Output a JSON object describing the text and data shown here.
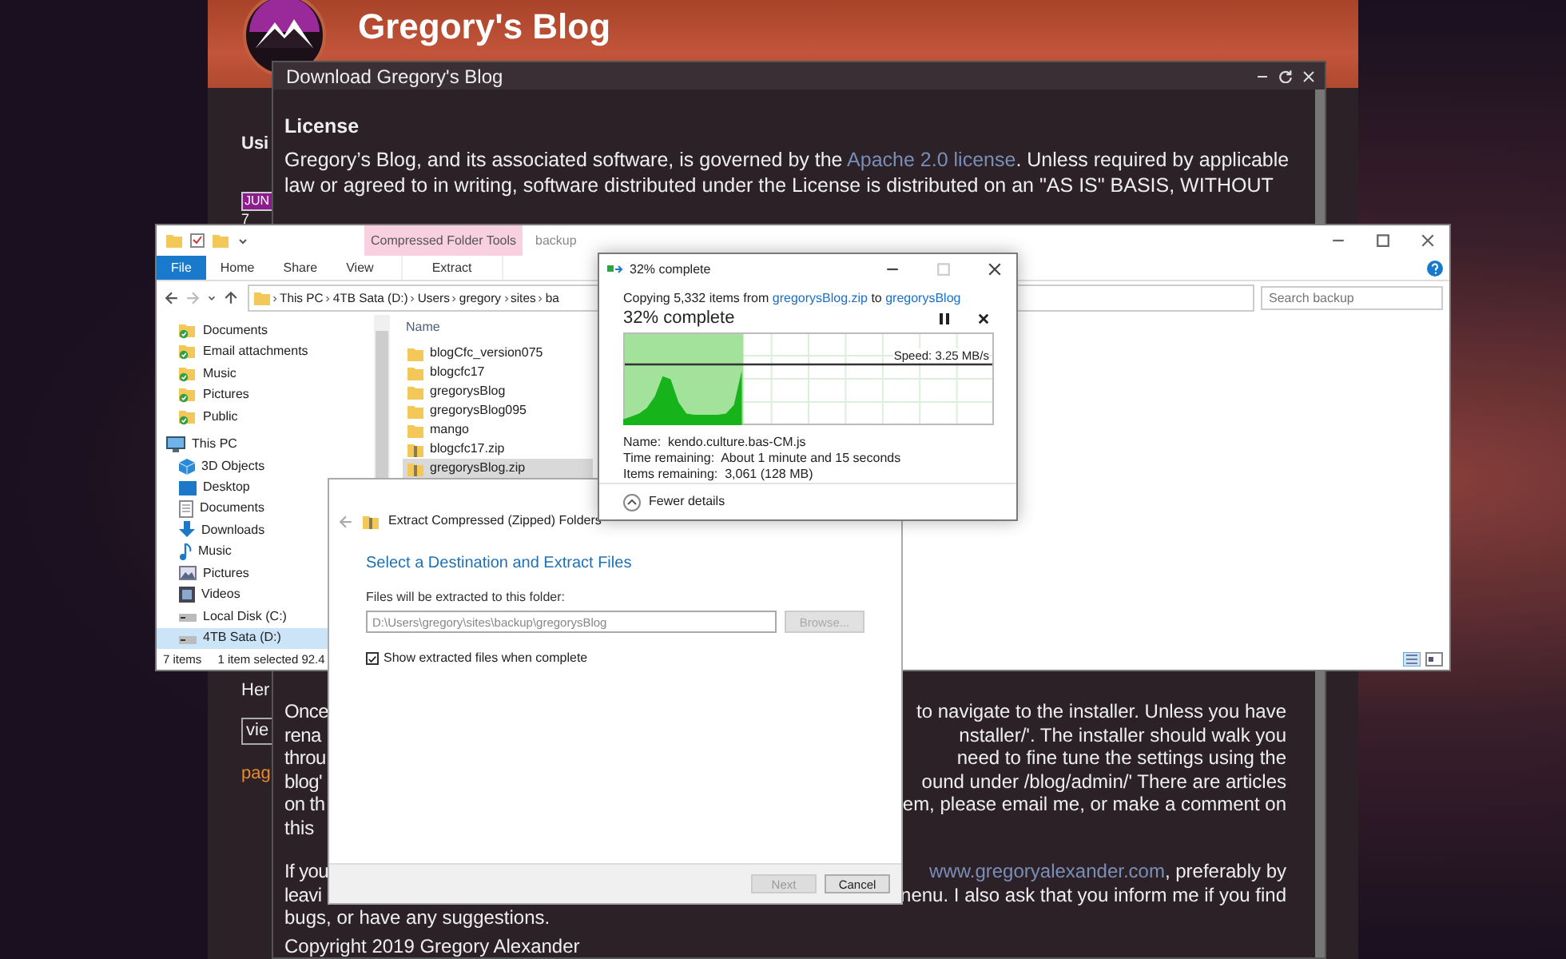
{
  "blog": {
    "title": "Gregory's Blog",
    "sidebar_fragments": [
      {
        "kind": "heading",
        "text": "Usi"
      },
      {
        "kind": "date-tab",
        "text": "JUN"
      },
      {
        "kind": "day",
        "text": "7"
      },
      {
        "kind": "text",
        "text": "Her"
      },
      {
        "kind": "tab",
        "text": "vie"
      },
      {
        "kind": "link",
        "text": "pag"
      }
    ]
  },
  "modal": {
    "title": "Download Gregory's Blog",
    "heading": "License",
    "license_line_1": {
      "before": "Gregory’s Blog, and its associated software, is governed by the ",
      "link": "Apache 2.0 license",
      "after": ". Unless required by applicable"
    },
    "license_line_2": "law or agreed to in writing, software distributed under the License is distributed on an \"AS IS\" BASIS, WITHOUT",
    "lower_lines": [
      {
        "left": "Once",
        "right": "to navigate to the installer. Unless you have"
      },
      {
        "left": "rena",
        "right": "nstaller/'. The installer should walk you"
      },
      {
        "left": "throu",
        "right": "need to fine tune the settings using the"
      },
      {
        "left": "blog'",
        "right": "ound under /blog/admin/' There are articles"
      },
      {
        "left": "on th",
        "right": "em, please email me, or make a comment on"
      },
      {
        "left": "this"
      },
      {
        "left": "If you",
        "link": "www.gregoryalexander.com",
        "right": ", preferably by"
      },
      {
        "left": "leavi",
        "right": "nenu. I also ask that you inform me if you find"
      },
      {
        "left": "bugs, or have any suggestions."
      },
      {
        "left": "Copyright 2019 Gregory Alexander"
      }
    ]
  },
  "explorer": {
    "context_tab": "Compressed Folder Tools",
    "title": "backup",
    "tabs": [
      {
        "label": "File",
        "selected": true
      },
      {
        "label": "Home",
        "selected": false
      },
      {
        "label": "Share",
        "selected": false
      },
      {
        "label": "View",
        "selected": false
      },
      {
        "label": "Extract",
        "selected": false
      }
    ],
    "path": [
      "This PC",
      "4TB Sata (D:)",
      "Users",
      "gregory",
      "sites",
      "ba"
    ],
    "search": {
      "placeholder": "Search backup"
    },
    "nav": [
      {
        "label": "Documents",
        "kind": "synced-folder",
        "selected": false
      },
      {
        "label": "Email attachments",
        "kind": "synced-folder",
        "selected": false
      },
      {
        "label": "Music",
        "kind": "synced-folder",
        "selected": false
      },
      {
        "label": "Pictures",
        "kind": "synced-folder",
        "selected": false
      },
      {
        "label": "Public",
        "kind": "shared-folder",
        "selected": false
      },
      {
        "label": "This PC",
        "kind": "computer",
        "selected": false,
        "children": [
          {
            "label": "3D Objects",
            "kind": "cube",
            "selected": false
          },
          {
            "label": "Desktop",
            "kind": "desktop",
            "selected": false
          },
          {
            "label": "Documents",
            "kind": "documents",
            "selected": false
          },
          {
            "label": "Downloads",
            "kind": "download",
            "selected": false
          },
          {
            "label": "Music",
            "kind": "music",
            "selected": false
          },
          {
            "label": "Pictures",
            "kind": "pictures",
            "selected": false
          },
          {
            "label": "Videos",
            "kind": "videos",
            "selected": false
          },
          {
            "label": "Local Disk (C:)",
            "kind": "disk",
            "selected": false
          },
          {
            "label": "4TB Sata (D:)",
            "kind": "disk",
            "selected": true
          }
        ]
      }
    ],
    "column": "Name",
    "files": [
      {
        "name": "blogCfc_version075",
        "kind": "folder",
        "selected": false
      },
      {
        "name": "blogcfc17",
        "kind": "folder",
        "selected": false
      },
      {
        "name": "gregorysBlog",
        "kind": "folder",
        "selected": false
      },
      {
        "name": "gregorysBlog095",
        "kind": "folder",
        "selected": false
      },
      {
        "name": "mango",
        "kind": "folder",
        "selected": false
      },
      {
        "name": "blogcfc17.zip",
        "kind": "zip",
        "selected": false
      },
      {
        "name": "gregorysBlog.zip",
        "kind": "zip",
        "selected": true
      }
    ],
    "status_count": "7 items",
    "status_selection": "1 item selected  92.4"
  },
  "copy": {
    "title": "32% complete",
    "prefix": "Copying 5,332 items from ",
    "source": "gregorysBlog.zip",
    "middle": " to ",
    "destination": "gregorysBlog",
    "heading": "32% complete",
    "level": 0.32,
    "speed": "Speed: 3.25 MB/s",
    "details": [
      {
        "label": "Name:",
        "value": "kendo.culture.bas-CM.js"
      },
      {
        "label": "Time remaining:",
        "value": "About 1 minute and 15 seconds"
      },
      {
        "label": "Items remaining:",
        "value": "3,061 (128 MB)"
      }
    ],
    "toggle": "Fewer details"
  },
  "extract": {
    "title": "Extract Compressed (Zipped) Folders",
    "heading": "Select a Destination and Extract Files",
    "field_label": "Files will be extracted to this folder:",
    "path": "D:\\Users\\gregory\\sites\\backup\\gregorysBlog",
    "browse": {
      "label": "Browse...",
      "disabled": true
    },
    "checkbox": {
      "label": "Show extracted files when complete",
      "checked": true
    },
    "buttons": [
      {
        "label": "Next",
        "disabled": true
      },
      {
        "label": "Cancel",
        "disabled": false
      }
    ]
  }
}
